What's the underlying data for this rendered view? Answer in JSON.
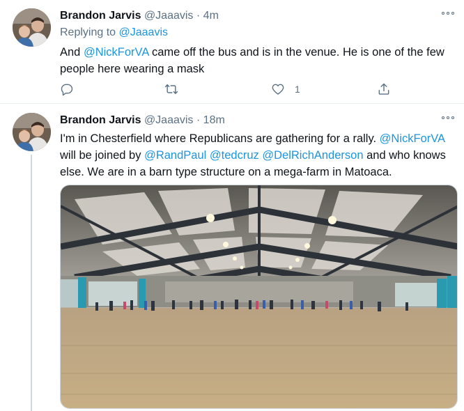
{
  "tweets": [
    {
      "author_name": "Brandon Jarvis",
      "author_handle": "@Jaaavis",
      "separator": "·",
      "time": "4m",
      "replying_prefix": "Replying to ",
      "replying_to": "@Jaaavis",
      "text_parts": {
        "p1": "And ",
        "m1": "@NickForVA",
        "p2": " came off the bus and is in the venue. He is one of the few people here wearing a mask"
      },
      "actions": {
        "reply_count": "",
        "retweet_count": "",
        "like_count": "1"
      },
      "icons": [
        "reply-icon",
        "retweet-icon",
        "like-icon",
        "share-icon",
        "more-icon"
      ]
    },
    {
      "author_name": "Brandon Jarvis",
      "author_handle": "@Jaaavis",
      "separator": "·",
      "time": "18m",
      "text_parts": {
        "p1": "I'm in Chesterfield where Republicans are gathering for a rally. ",
        "m1": "@NickForVA",
        "p2": " will be joined by ",
        "m2": "@RandPaul",
        "p3": " ",
        "m3": "@tedcruz",
        "p4": " ",
        "m4": "@DelRichAnderson",
        "p5": " and who knows else. We are in a barn type structure on a mega-farm in Matoaca."
      },
      "media": {
        "kind": "photo",
        "subject": "indoor arena with dirt floor and crowd"
      }
    }
  ],
  "colors": {
    "link": "#1b95e0",
    "secondary_text": "#5b7083",
    "primary_text": "#0f1419",
    "divider": "#e6ecf0",
    "thread_line": "#cfd9de"
  }
}
